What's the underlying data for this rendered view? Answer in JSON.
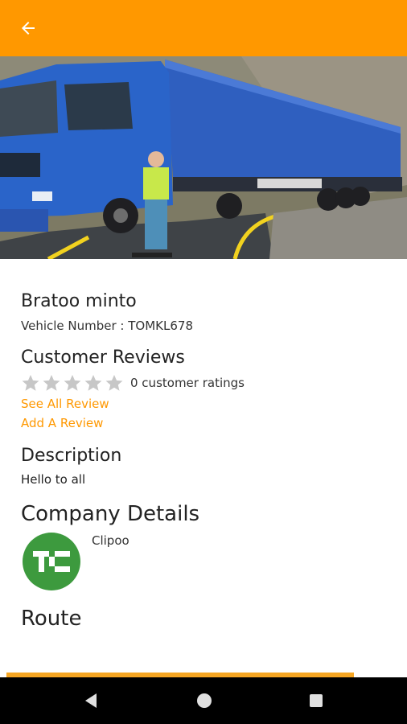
{
  "appbar": {
    "color": "#FF9800",
    "back_icon": "arrow-left-icon"
  },
  "hero": {
    "alt": "truck-photo"
  },
  "vehicle": {
    "name": "Bratoo minto",
    "number_line": "Vehicle Number : TOMKL678"
  },
  "reviews": {
    "heading": "Customer Reviews",
    "stars_filled": 0,
    "stars_total": 5,
    "ratings_text": "0 customer ratings",
    "see_all": "See All Review",
    "add": "Add A Review"
  },
  "description": {
    "heading": "Description",
    "text": "Hello to all"
  },
  "company": {
    "heading": "Company Details",
    "name": "Clipoo",
    "logo_color": "#3d9a3e"
  },
  "route": {
    "heading": "Route"
  },
  "navbar": {
    "back": "back-triangle-icon",
    "home": "home-circle-icon",
    "recents": "recents-square-icon"
  }
}
